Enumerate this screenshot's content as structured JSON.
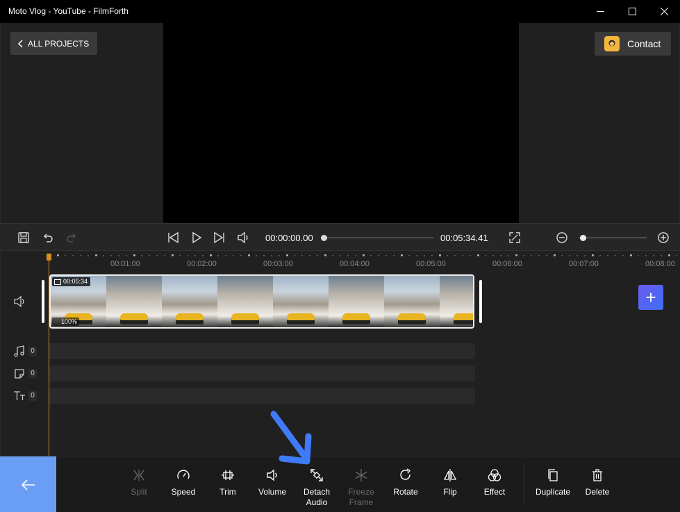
{
  "window": {
    "title": "Moto Vlog - YouTube - FilmForth"
  },
  "header": {
    "all_projects_label": "ALL PROJECTS",
    "contact_label": "Contact"
  },
  "player": {
    "current_time": "00:00:00.00",
    "total_time": "00:05:34.41",
    "progress": 0,
    "zoom_level": 0.07
  },
  "ruler": {
    "labels": [
      "00:01:00",
      "00:02:00",
      "00:03:00",
      "00:04:00",
      "00:05:00",
      "00:06:00",
      "00:07:00",
      "00:08:00"
    ]
  },
  "clip": {
    "duration": "00:05:34",
    "volume": "100%"
  },
  "tracks": {
    "music_count": "0",
    "sticker_count": "0",
    "text_count": "0"
  },
  "toolbar": {
    "split": "Split",
    "speed": "Speed",
    "trim": "Trim",
    "volume": "Volume",
    "detach_audio": "Detach Audio",
    "freeze_frame": "Freeze Frame",
    "rotate": "Rotate",
    "flip": "Flip",
    "effect": "Effect",
    "duplicate": "Duplicate",
    "delete": "Delete"
  },
  "colors": {
    "accent": "#3b82f6",
    "playhead": "#d9901f",
    "back_button": "#6a9ef5",
    "add_button": "#5366f0",
    "annotation_arrow": "#3f7bf6"
  }
}
